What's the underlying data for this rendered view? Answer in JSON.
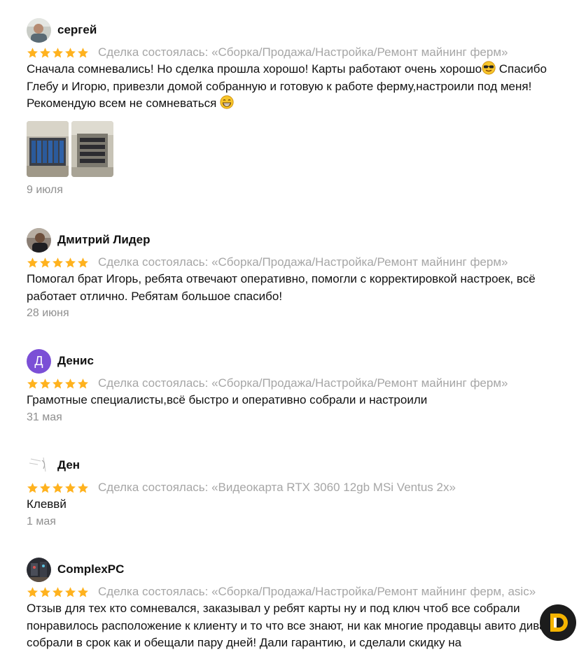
{
  "reviews": [
    {
      "name": "сергей",
      "rating": 5,
      "deal": "Сделка состоялась: «Сборка/Продажа/Настройка/Ремонт майнинг ферм»",
      "text_parts": [
        "Сначала сомневались! Но сделка прошла хорошо! Карты работают очень хорошо",
        " Спасибо Глебу и Игорю, привезли домой собранную и готовую к работе ферму,настроили под меня! Рекомендую всем не сомневаться "
      ],
      "emoji": [
        "sunglasses-emoji",
        "grin-emoji"
      ],
      "photos": [
        "photo-mining-rig-1",
        "photo-mining-rig-2"
      ],
      "date": "9 июля"
    },
    {
      "name": "Дмитрий Лидер",
      "rating": 5,
      "deal": "Сделка состоялась: «Сборка/Продажа/Настройка/Ремонт майнинг ферм»",
      "text": "Помогал брат Игорь, ребята отвечают оперативно, помогли с корректировкой настроек, всё работает отлично. Ребятам большое спасибо!",
      "date": "28 июня"
    },
    {
      "name": "Денис",
      "avatar_letter": "Д",
      "avatar_color": "#7b4fd6",
      "rating": 5,
      "deal": "Сделка состоялась: «Сборка/Продажа/Настройка/Ремонт майнинг ферм»",
      "text": "Грамотные специалисты,всё быстро и оперативно собрали и настроили",
      "date": "31 мая"
    },
    {
      "name": "Ден",
      "rating": 5,
      "deal": "Сделка состоялась: «Видеокарта RTX 3060 12gb MSi Ventus 2x»",
      "text": "Клеввй",
      "date": "1 мая"
    },
    {
      "name": "ComplexPC",
      "rating": 5,
      "deal": "Сделка состоялась: «Сборка/Продажа/Настройка/Ремонт майнинг ферм, asic»",
      "text": "Отзыв для тех кто сомневался, заказывал у ребят карты ну и под ключ чтоб все собрали понравилось расположение к клиенту и то что все знают, ни как многие продавцы авито диванах, собрали в срок как и обещали пару дней! Дали гарантию, и сделали скидку на"
    }
  ],
  "colors": {
    "star": "#ffb21e",
    "muted": "#a6a6a6",
    "date": "#8f8f8f"
  },
  "widget": {
    "icon": "chat-widget-icon",
    "accent": "#f5b400"
  }
}
